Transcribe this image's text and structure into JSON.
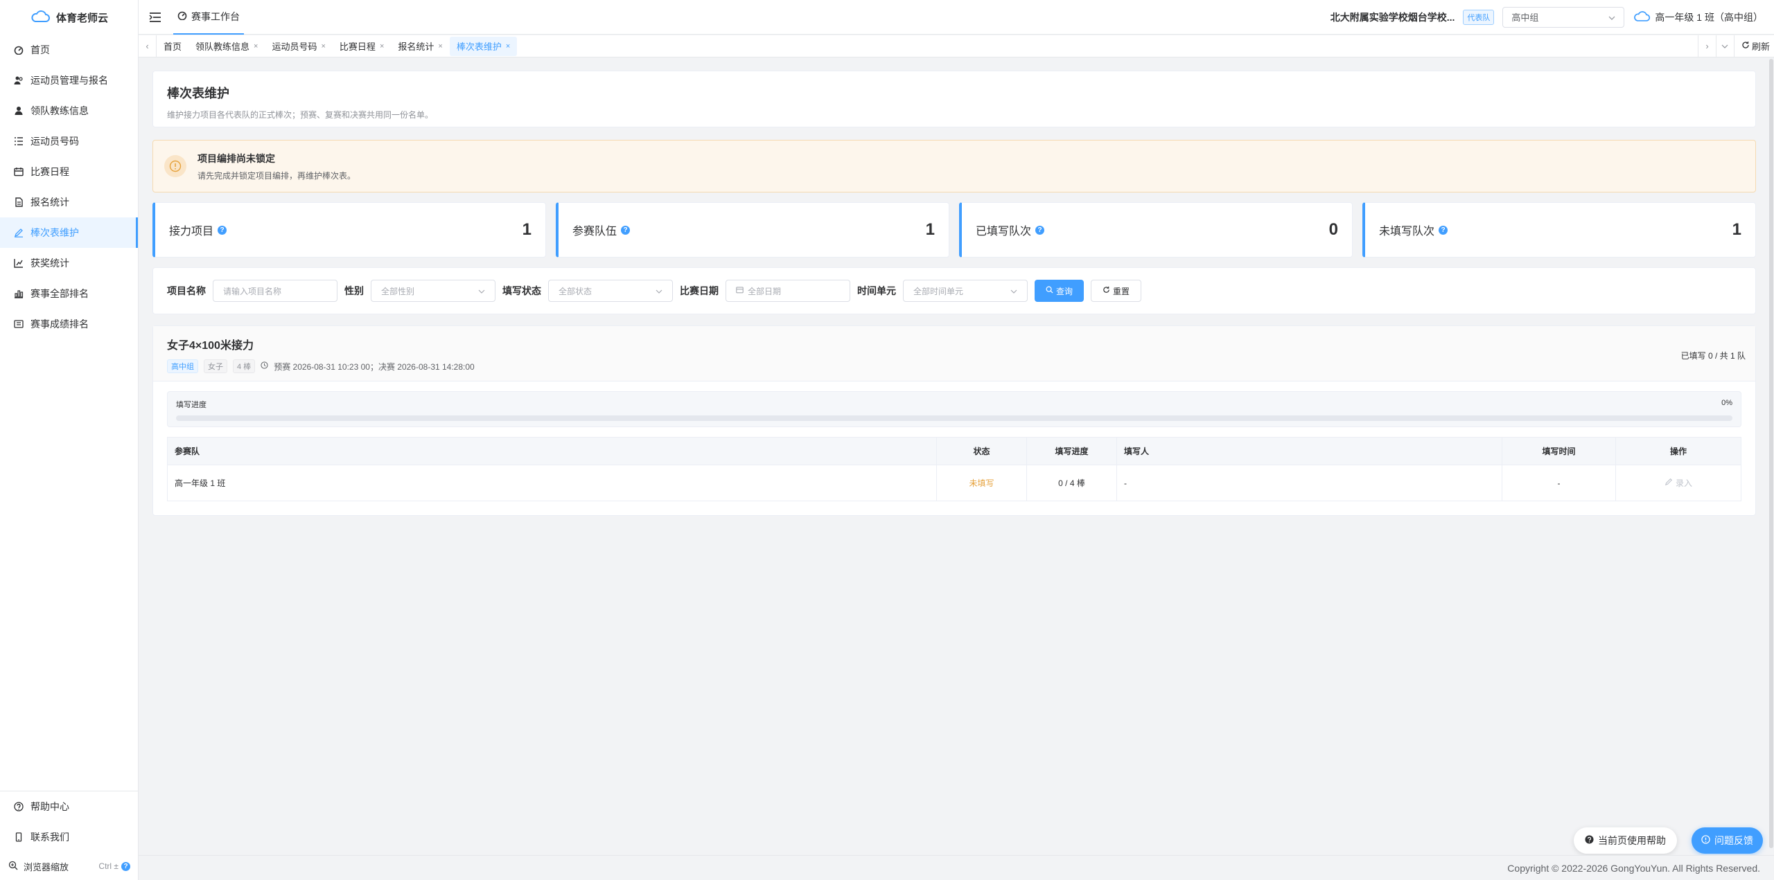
{
  "brand": {
    "name": "体育老师云"
  },
  "sidebar": {
    "items": [
      {
        "label": "首页",
        "icon": "dashboard-icon",
        "active": false
      },
      {
        "label": "运动员管理与报名",
        "icon": "users-icon",
        "active": false
      },
      {
        "label": "领队教练信息",
        "icon": "user-icon",
        "active": false
      },
      {
        "label": "运动员号码",
        "icon": "list-icon",
        "active": false
      },
      {
        "label": "比赛日程",
        "icon": "calendar-icon",
        "active": false
      },
      {
        "label": "报名统计",
        "icon": "document-icon",
        "active": false
      },
      {
        "label": "棒次表维护",
        "icon": "edit-icon",
        "active": true
      },
      {
        "label": "获奖统计",
        "icon": "chart-icon",
        "active": false
      },
      {
        "label": "赛事全部排名",
        "icon": "bar-chart-icon",
        "active": false
      },
      {
        "label": "赛事成绩排名",
        "icon": "tickets-icon",
        "active": false
      }
    ],
    "bottom": [
      {
        "label": "帮助中心",
        "icon": "help-icon"
      },
      {
        "label": "联系我们",
        "icon": "phone-icon"
      }
    ],
    "zoom": {
      "label": "浏览器缩放",
      "shortcut": "Ctrl ±"
    }
  },
  "header": {
    "workspace_tab": "赛事工作台",
    "school": "北大附属实验学校烟台学校...",
    "badge": "代表队",
    "group_select": "高中组",
    "class_name": "高一年级 1 班（高中组）"
  },
  "tabs": [
    {
      "label": "首页",
      "closable": false,
      "active": false
    },
    {
      "label": "领队教练信息",
      "closable": true,
      "active": false
    },
    {
      "label": "运动员号码",
      "closable": true,
      "active": false
    },
    {
      "label": "比赛日程",
      "closable": true,
      "active": false
    },
    {
      "label": "报名统计",
      "closable": true,
      "active": false
    },
    {
      "label": "棒次表维护",
      "closable": true,
      "active": true
    }
  ],
  "refresh_label": "刷新",
  "page": {
    "title": "棒次表维护",
    "subtitle": "维护接力项目各代表队的正式棒次；预赛、复赛和决赛共用同一份名单。"
  },
  "alert": {
    "title": "项目编排尚未锁定",
    "message": "请先完成并锁定项目编排，再维护棒次表。"
  },
  "stats": [
    {
      "label": "接力项目",
      "value": "1"
    },
    {
      "label": "参赛队伍",
      "value": "1"
    },
    {
      "label": "已填写队次",
      "value": "0"
    },
    {
      "label": "未填写队次",
      "value": "1"
    }
  ],
  "filters": {
    "name_label": "项目名称",
    "name_placeholder": "请输入项目名称",
    "gender_label": "性别",
    "gender_placeholder": "全部性别",
    "status_label": "填写状态",
    "status_placeholder": "全部状态",
    "date_label": "比赛日期",
    "date_placeholder": "全部日期",
    "time_label": "时间单元",
    "time_placeholder": "全部时间单元",
    "search_btn": "查询",
    "reset_btn": "重置"
  },
  "event": {
    "name": "女子4×100米接力",
    "tags": [
      "高中组",
      "女子",
      "4 棒"
    ],
    "schedule": "预赛 2026-08-31 10:23 00；决赛 2026-08-31 14:28:00",
    "filled_count": "已填写 0 / 共 1 队",
    "progress_label": "填写进度",
    "progress_text": "0%",
    "progress_value": 0,
    "columns": [
      "参赛队",
      "状态",
      "填写进度",
      "填写人",
      "填写时间",
      "操作"
    ],
    "rows": [
      {
        "team": "高一年级 1 班",
        "status": "未填写",
        "progress": "0 / 4 棒",
        "filler": "-",
        "time": "-",
        "action": "录入"
      }
    ]
  },
  "footer": {
    "copyright": "Copyright © 2022-2026 GongYouYun. All Rights Reserved."
  },
  "floating": {
    "help": "当前页使用帮助",
    "feedback": "问题反馈"
  },
  "colors": {
    "primary": "#409eff",
    "warning": "#e6a23c"
  }
}
